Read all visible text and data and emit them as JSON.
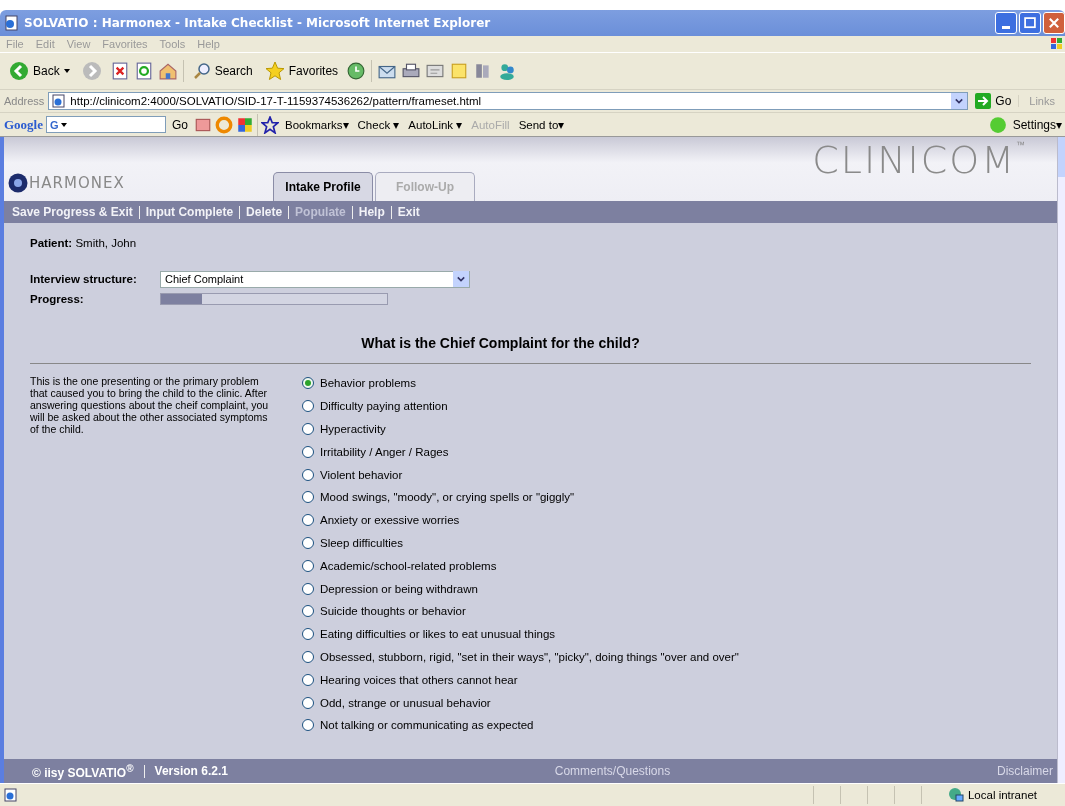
{
  "window": {
    "title": "SOLVATIO : Harmonex - Intake Checklist - Microsoft Internet Explorer"
  },
  "menu": [
    "File",
    "Edit",
    "View",
    "Favorites",
    "Tools",
    "Help"
  ],
  "toolbar": {
    "back": "Back",
    "search": "Search",
    "favorites": "Favorites"
  },
  "address_bar": {
    "label": "Address",
    "url": "http://clinicom2:4000/SOLVATIO/SID-17-T-1159374536262/pattern/frameset.html",
    "go": "Go",
    "links": "Links"
  },
  "google_bar": {
    "brand": "Google",
    "field": "G",
    "go": "Go",
    "items": [
      {
        "label": "Bookmarks▾",
        "disabled": false
      },
      {
        "label": "Check ▾",
        "disabled": false
      },
      {
        "label": "AutoLink ▾",
        "disabled": false
      },
      {
        "label": "AutoFill",
        "disabled": true
      },
      {
        "label": "Send to▾",
        "disabled": false
      }
    ],
    "settings": "Settings▾"
  },
  "header": {
    "logo": "HARMONEX",
    "brand": "CLINICOM",
    "trademark": "™"
  },
  "tabs": [
    {
      "label": "Intake Profile",
      "selected": true
    },
    {
      "label": "Follow-Up",
      "selected": false
    }
  ],
  "actions": [
    {
      "label": "Save Progress & Exit",
      "disabled": false
    },
    {
      "label": "Input Complete",
      "disabled": false
    },
    {
      "label": "Delete",
      "disabled": false
    },
    {
      "label": "Populate",
      "disabled": true
    },
    {
      "label": "Help",
      "disabled": false
    },
    {
      "label": "Exit",
      "disabled": false
    }
  ],
  "patient": {
    "label": "Patient:",
    "value": "Smith, John"
  },
  "interview_structure": {
    "label": "Interview structure:",
    "value": "Chief Complaint"
  },
  "progress": {
    "label": "Progress:",
    "level": 0.18
  },
  "question": "What is the Chief Complaint for the child?",
  "description": "This is the one presenting or the primary problem that caused you to bring the child to the clinic. After answering questions about the cheif complaint, you will be asked about the other associated symptoms of the child.",
  "options": [
    {
      "label": "Behavior problems",
      "selected": true
    },
    {
      "label": "Difficulty paying attention",
      "selected": false
    },
    {
      "label": "Hyperactivity",
      "selected": false
    },
    {
      "label": "Irritability / Anger / Rages",
      "selected": false
    },
    {
      "label": "Violent behavior",
      "selected": false
    },
    {
      "label": "Mood swings, \"moody\", or crying spells or \"giggly\"",
      "selected": false
    },
    {
      "label": "Anxiety or exessive worries",
      "selected": false
    },
    {
      "label": "Sleep difficulties",
      "selected": false
    },
    {
      "label": "Academic/school-related problems",
      "selected": false
    },
    {
      "label": "Depression or being withdrawn",
      "selected": false
    },
    {
      "label": "Suicide thoughts or behavior",
      "selected": false
    },
    {
      "label": "Eating difficulties or likes to eat unusual things",
      "selected": false
    },
    {
      "label": "Obsessed, stubborn, rigid, \"set in their ways\", \"picky\", doing things \"over and over\"",
      "selected": false
    },
    {
      "label": "Hearing voices that others cannot hear",
      "selected": false
    },
    {
      "label": "Odd, strange or unusual behavior",
      "selected": false
    },
    {
      "label": "Not talking or communicating as expected",
      "selected": false
    }
  ],
  "footer": {
    "copyright": "© iisy SOLVATIO$^{®}$",
    "version": "Version 6.2.1",
    "comments": "Comments/Questions",
    "disclaimer": "Disclaimer"
  },
  "status_bar": {
    "zone": "Local intranet"
  }
}
